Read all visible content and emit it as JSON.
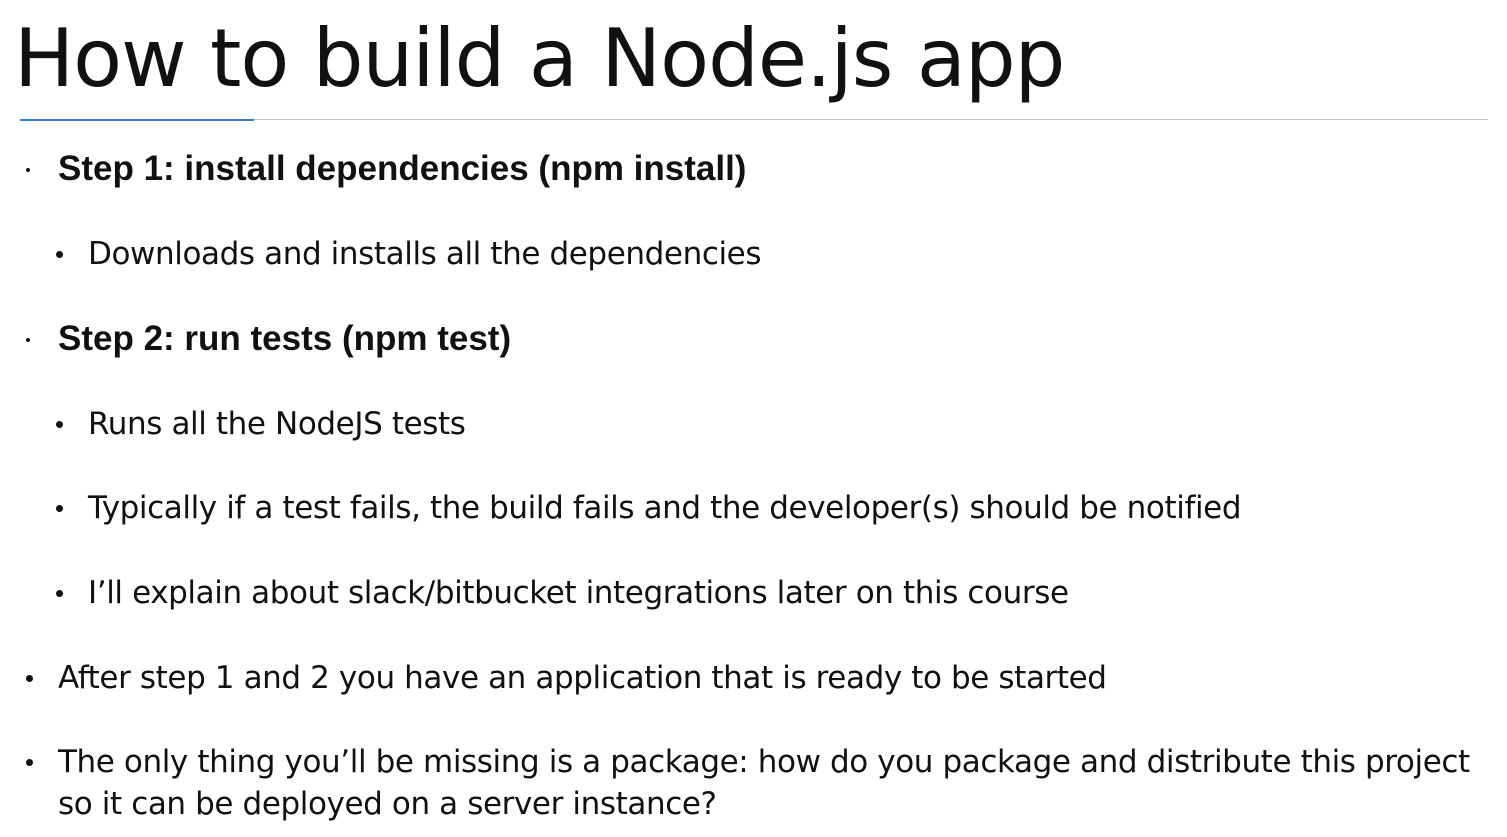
{
  "slide": {
    "title": "How to build a Node.js app",
    "items": [
      {
        "level": 1,
        "bold": true,
        "text": "Step 1: install dependencies (npm install)"
      },
      {
        "level": 2,
        "bold": false,
        "text": "Downloads and installs all the dependencies"
      },
      {
        "level": 1,
        "bold": true,
        "text": "Step 2: run tests (npm test)"
      },
      {
        "level": 2,
        "bold": false,
        "text": "Runs all the NodeJS tests"
      },
      {
        "level": 2,
        "bold": false,
        "text": "Typically if a test fails, the build fails and the developer(s) should be notified"
      },
      {
        "level": 2,
        "bold": false,
        "text": "I’ll explain about slack/bitbucket integrations later on this course"
      },
      {
        "level": 1,
        "bold": false,
        "text": "After step 1 and 2 you have an application that is ready to be started"
      },
      {
        "level": 1,
        "bold": false,
        "text": "The only thing you’ll be missing is a package: how do you package and distribute this project so it can be deployed on a server instance?"
      }
    ]
  },
  "colors": {
    "text": "#111111",
    "rule": "#c8c8c8",
    "accent": "#3a78c8",
    "background": "#ffffff"
  }
}
